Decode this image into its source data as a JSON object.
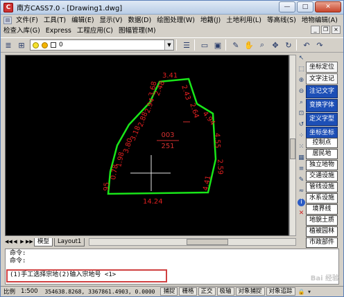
{
  "window": {
    "title": "南方CASS7.0 - [Drawing1.dwg]",
    "controls": {
      "minimize": "—",
      "maximize": "□",
      "close": "✕"
    }
  },
  "menus": {
    "row1": [
      "文件(F)",
      "工具(T)",
      "编辑(E)",
      "显示(V)",
      "数据(D)",
      "绘图处理(W)",
      "地籍(J)",
      "土地利用(L)",
      "等高线(S)",
      "地物编辑(A)"
    ],
    "row2": [
      "检查入库(G)",
      "Express",
      "工程应用(C)",
      "图幅管理(M)"
    ],
    "mdi_controls": {
      "minimize": "_",
      "restore": "❐",
      "close": "×"
    }
  },
  "toolbar": {
    "layer_name": "0",
    "icons": [
      "layers-icon",
      "layer-props-icon",
      "line-props-icon",
      "new-icon",
      "save-icon",
      "pencil-icon",
      "pan-icon",
      "zoom-icon",
      "move-icon",
      "rotate-icon",
      "undo-icon",
      "redo-icon"
    ]
  },
  "drawing": {
    "parcel": {
      "number": "003",
      "area_code": "251",
      "edge_labels": [
        {
          "text": "3.41"
        },
        {
          "text": "2.43"
        },
        {
          "text": "2.64"
        },
        {
          "text": "4.94"
        },
        {
          "text": "4.55"
        },
        {
          "text": "2.59"
        },
        {
          "text": "4.41"
        },
        {
          "text": "14.24"
        },
        {
          "text": "2.48"
        },
        {
          "text": "3.68"
        },
        {
          "text": "2.94"
        },
        {
          "text": "2.88"
        },
        {
          "text": "3.18"
        },
        {
          "text": "3.80"
        },
        {
          "text": "1.98"
        },
        {
          "text": "0.78"
        },
        {
          "text": "95"
        }
      ]
    }
  },
  "layout_tabs": {
    "nav": [
      "◀◀",
      "◀",
      "▶",
      "▶▶"
    ],
    "tabs": [
      "模型",
      "Layout1"
    ],
    "active": "模型"
  },
  "right_panel": {
    "top_buttons": [
      "坐标定位",
      "文字注记",
      "注记文字",
      "变换字体",
      "定义字型",
      "坐标坐标"
    ],
    "bottom_buttons": [
      "控制点",
      "居民地",
      "独立地物",
      "交通设施",
      "管线设施",
      "水系设施",
      "境界线",
      "地貌土质",
      "植被园林",
      "市政部件"
    ]
  },
  "command": {
    "lines": [
      "命令:",
      "命令:"
    ],
    "prompt": "(1)手工选择宗地(2)输入宗地号 <1>"
  },
  "statusbar": {
    "scale_label": "比例",
    "scale_value": "1:500",
    "coords": "354638.8268, 3367861.4903, 0.0000",
    "toggles": [
      "捕捉",
      "栅格",
      "正交",
      "极轴",
      "对象捕捉",
      "对象追踪"
    ]
  },
  "colors": {
    "parcel_line": "#19e619",
    "label_red": "#e02020",
    "parcel_text": "#d63030",
    "panel_blue": "#1d4fb6"
  },
  "watermark": "Bai 经验"
}
